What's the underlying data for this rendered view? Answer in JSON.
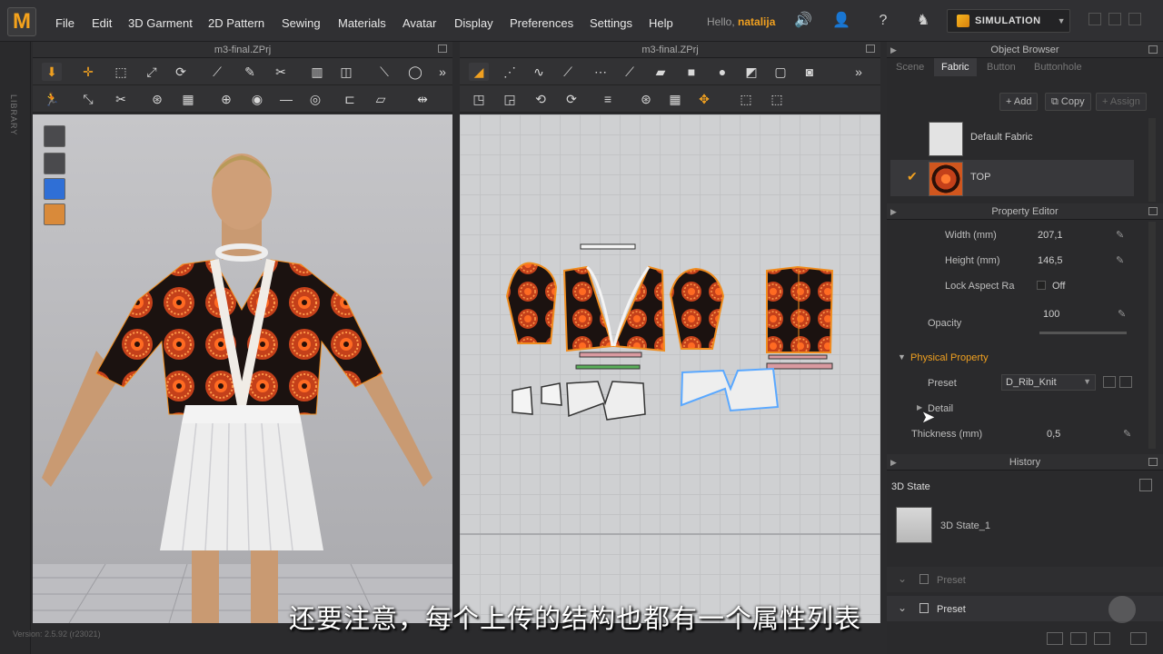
{
  "app": {
    "logo": "M"
  },
  "menu": [
    "File",
    "Edit",
    "3D Garment",
    "2D Pattern",
    "Sewing",
    "Materials",
    "Avatar",
    "Display",
    "Preferences",
    "Settings",
    "Help"
  ],
  "user": {
    "hello": "Hello,",
    "name": "natalija"
  },
  "simulation": {
    "label": "SIMULATION"
  },
  "sidebar": {
    "library": "LIBRARY"
  },
  "panes": {
    "left_title": "m3-final.ZPrj",
    "right_title": "m3-final.ZPrj"
  },
  "object_browser": {
    "title": "Object Browser",
    "tabs": [
      "Scene",
      "Fabric",
      "Button",
      "Buttonhole"
    ],
    "active_tab": "Fabric",
    "buttons": {
      "add": "Add",
      "copy": "Copy",
      "assign": "Assign"
    },
    "fabrics": [
      {
        "name": "Default Fabric"
      },
      {
        "name": "TOP",
        "checked": true
      }
    ]
  },
  "property_editor": {
    "title": "Property Editor",
    "width": {
      "label": "Width (mm)",
      "value": "207,1"
    },
    "height": {
      "label": "Height (mm)",
      "value": "146,5"
    },
    "lock": {
      "label": "Lock Aspect Ra",
      "value": "Off"
    },
    "opacity": {
      "label": "Opacity",
      "value": "100"
    },
    "physical": {
      "label": "Physical Property"
    },
    "preset": {
      "label": "Preset",
      "value": "D_Rib_Knit"
    },
    "detail": {
      "label": "Detail"
    },
    "thickness": {
      "label": "Thickness (mm)",
      "value": "0,5"
    }
  },
  "history": {
    "title": "History",
    "state_header": "3D State",
    "state_item": "3D State_1",
    "preset1": "Preset",
    "preset2": "Preset"
  },
  "subtitle": "还要注意，每个上传的结构也都有一个属性列表",
  "status": {
    "version": "Version: 2.5.92   (r23021)"
  },
  "colors": {
    "accent": "#f0a020",
    "fabric": "#e0541c",
    "outline": "#f08c1e",
    "select": "#5aa8ff"
  }
}
